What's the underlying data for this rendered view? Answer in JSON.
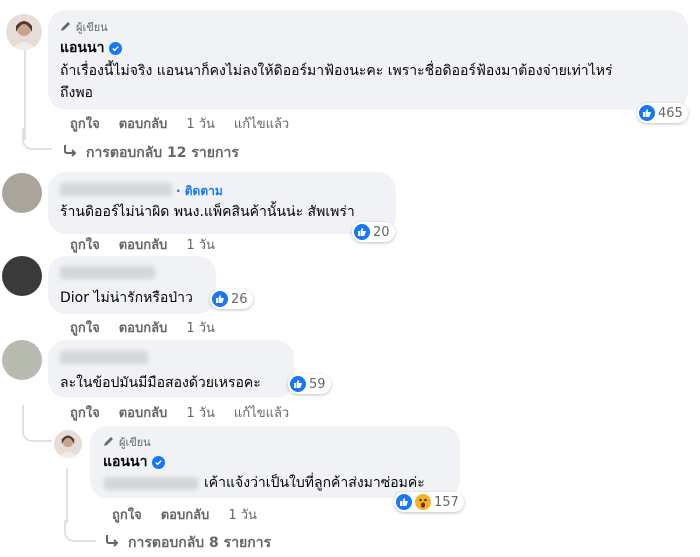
{
  "comments": [
    {
      "author_tag": "ผู้เขียน",
      "name": "แอนนา",
      "text_line1": "ถ้าเรื่องนี้ไม่จริง แอนนาก็คงไม่ลงให้ดิออร์มาฟ้องนะคะ เพราะชื่อดิออร์ฟ้องมาต้องจ่ายเท่าไหร่",
      "text_line2": "ถึงพอ",
      "reaction_count": "465",
      "like": "ถูกใจ",
      "reply": "ตอบกลับ",
      "time": "1 วัน",
      "edited": "แก้ไขแล้ว",
      "replies_label": "การตอบกลับ 12 รายการ"
    },
    {
      "follow": "· ติดตาม",
      "text": "ร้านดิออร์ไม่น่าผิด พนง.แพ็คสินค้านั้นน่ะ สัพเพร่า",
      "reaction_count": "20",
      "like": "ถูกใจ",
      "reply": "ตอบกลับ",
      "time": "1 วัน"
    },
    {
      "text": "Dior ไม่น่ารักหรือป่าว",
      "reaction_count": "26",
      "like": "ถูกใจ",
      "reply": "ตอบกลับ",
      "time": "1 วัน"
    },
    {
      "text": "ละในข้อปมันมีมือสองด้วยเหรอคะ",
      "reaction_count": "59",
      "like": "ถูกใจ",
      "reply": "ตอบกลับ",
      "time": "1 วัน",
      "edited": "แก้ไขแล้ว"
    }
  ],
  "nested_reply": {
    "author_tag": "ผู้เขียน",
    "name": "แอนนา",
    "text": "เค้าแจ้งว่าเป็นใบที่ลูกค้าส่งมาซ่อมค่ะ",
    "reaction_count": "157",
    "like": "ถูกใจ",
    "reply": "ตอบกลับ",
    "time": "1 วัน",
    "replies_label": "การตอบกลับ 8 รายการ"
  },
  "colors": {
    "accent": "#1877f2",
    "bubble": "#f0f2f5",
    "muted": "#65676b"
  }
}
